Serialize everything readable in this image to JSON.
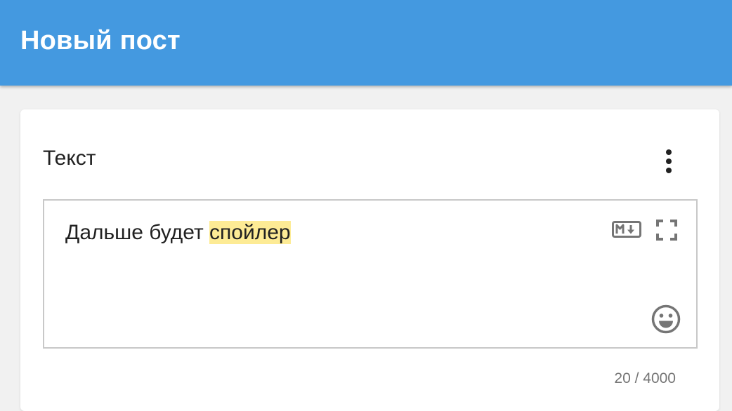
{
  "app_bar": {
    "title": "Новый пост",
    "background": "#4499e0"
  },
  "section": {
    "title": "Текст",
    "more_icon": "more-vertical-icon"
  },
  "editor": {
    "text_plain": "Дальше будет ",
    "text_highlighted": "спойлер",
    "highlight_color": "#fdeb95",
    "icons": [
      "markdown-icon",
      "fullscreen-icon",
      "emoji-icon"
    ]
  },
  "counter": {
    "text": "20 / 4000"
  }
}
